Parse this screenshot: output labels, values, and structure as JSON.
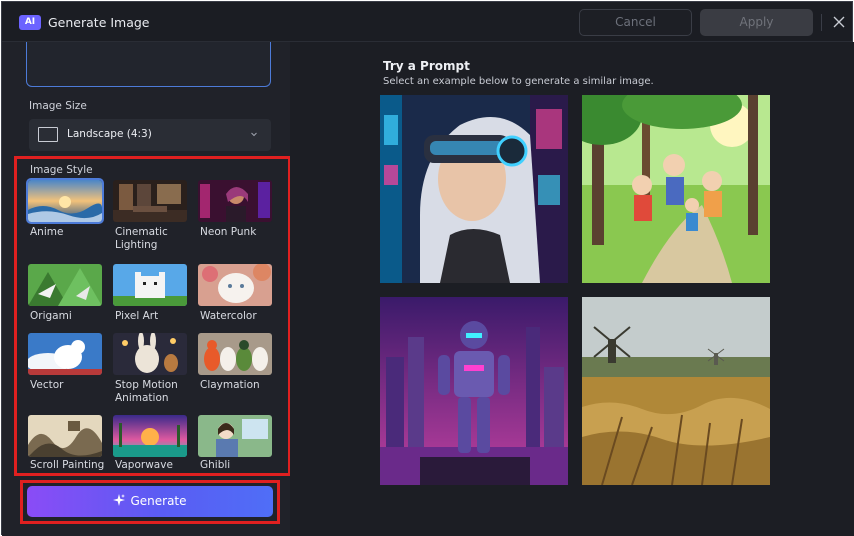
{
  "window": {
    "badge": "AI",
    "title": "Generate Image",
    "cancel_label": "Cancel",
    "apply_label": "Apply"
  },
  "left": {
    "image_size_label": "Image Size",
    "image_size_value": "Landscape (4:3)",
    "image_style_label": "Image Style",
    "styles": [
      {
        "label": "Anime",
        "selected": true
      },
      {
        "label": "Cinematic Lighting"
      },
      {
        "label": "Neon Punk"
      },
      {
        "label": "Origami"
      },
      {
        "label": "Pixel Art"
      },
      {
        "label": "Watercolor"
      },
      {
        "label": "Vector"
      },
      {
        "label": "Stop Motion Animation"
      },
      {
        "label": "Claymation"
      },
      {
        "label": "Scroll Painting"
      },
      {
        "label": "Vaporwave"
      },
      {
        "label": "Ghibli"
      }
    ],
    "generate_label": "Generate"
  },
  "right": {
    "title": "Try a Prompt",
    "subtitle": "Select an example below to generate a similar image."
  },
  "colors": {
    "accent": "#4d7bd8",
    "highlight": "#e02020",
    "generate_start": "#8a4cf6",
    "generate_end": "#4f6ef7"
  }
}
